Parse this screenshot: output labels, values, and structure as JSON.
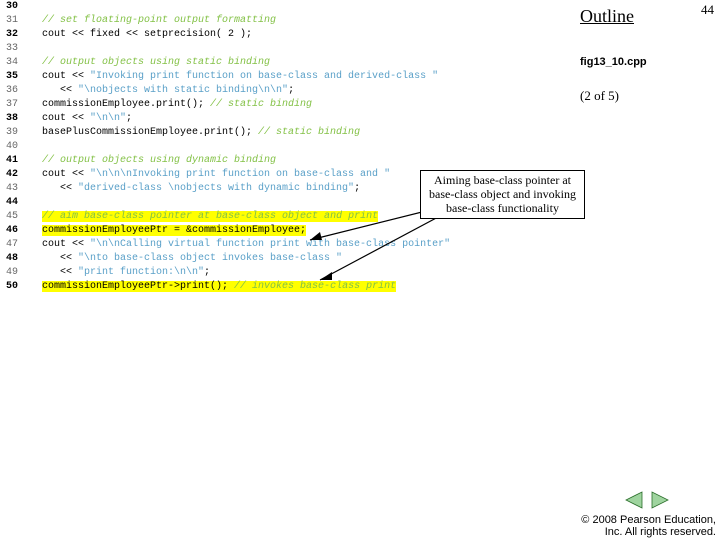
{
  "sidebar": {
    "outline": "Outline",
    "page_number": "44",
    "filename": "fig13_10.cpp",
    "progress": "(2 of 5)"
  },
  "callout": {
    "text": "Aiming base-class pointer at base-class object and invoking base-class functionality"
  },
  "copyright": {
    "line1": "© 2008 Pearson Education,",
    "line2": "Inc.  All rights reserved."
  },
  "nav": {
    "prev": "◀",
    "next": "▶"
  },
  "code": {
    "lines": [
      {
        "n": "30",
        "bold": true,
        "seg": []
      },
      {
        "n": "31",
        "seg": [
          {
            "t": "   "
          },
          {
            "t": "// set floating-point output formatting",
            "c": "comment"
          }
        ]
      },
      {
        "n": "32",
        "bold": true,
        "seg": [
          {
            "t": "   cout << fixed << setprecision( 2 );"
          }
        ]
      },
      {
        "n": "33",
        "seg": []
      },
      {
        "n": "34",
        "seg": [
          {
            "t": "   "
          },
          {
            "t": "// output objects using static binding",
            "c": "comment"
          }
        ]
      },
      {
        "n": "35",
        "bold": true,
        "seg": [
          {
            "t": "   cout << "
          },
          {
            "t": "\"Invoking print function on base-class and derived-class \"",
            "c": "str"
          }
        ]
      },
      {
        "n": "36",
        "seg": [
          {
            "t": "      << "
          },
          {
            "t": "\"\\nobjects with static binding\\n\\n\"",
            "c": "str"
          },
          {
            "t": ";"
          }
        ]
      },
      {
        "n": "37",
        "seg": [
          {
            "t": "   commissionEmployee.print(); "
          },
          {
            "t": "// static binding",
            "c": "comment"
          }
        ]
      },
      {
        "n": "38",
        "bold": true,
        "seg": [
          {
            "t": "   cout << "
          },
          {
            "t": "\"\\n\\n\"",
            "c": "str"
          },
          {
            "t": ";"
          }
        ]
      },
      {
        "n": "39",
        "seg": [
          {
            "t": "   basePlusCommissionEmployee.print(); "
          },
          {
            "t": "// static binding",
            "c": "comment"
          }
        ]
      },
      {
        "n": "40",
        "seg": []
      },
      {
        "n": "41",
        "bold": true,
        "seg": [
          {
            "t": "   "
          },
          {
            "t": "// output objects using dynamic binding",
            "c": "comment"
          }
        ]
      },
      {
        "n": "42",
        "bold": true,
        "seg": [
          {
            "t": "   cout << "
          },
          {
            "t": "\"\\n\\n\\nInvoking print function on base-class and \"",
            "c": "str"
          }
        ]
      },
      {
        "n": "43",
        "seg": [
          {
            "t": "      << "
          },
          {
            "t": "\"derived-class \\nobjects with dynamic binding\"",
            "c": "str"
          },
          {
            "t": ";"
          }
        ]
      },
      {
        "n": "44",
        "bold": true,
        "seg": []
      },
      {
        "n": "45",
        "seg": [
          {
            "t": "   "
          },
          {
            "t": "// aim base-class pointer at base-class object and print",
            "c": "comment hl"
          }
        ]
      },
      {
        "n": "46",
        "bold": true,
        "seg": [
          {
            "t": "   "
          },
          {
            "t": "commissionEmployeePtr = &commissionEmployee;",
            "c": "hl"
          }
        ]
      },
      {
        "n": "47",
        "seg": [
          {
            "t": "   cout << "
          },
          {
            "t": "\"\\n\\nCalling virtual function print with base-class pointer\"",
            "c": "str"
          }
        ]
      },
      {
        "n": "48",
        "bold": true,
        "seg": [
          {
            "t": "      << "
          },
          {
            "t": "\"\\nto base-class object invokes base-class \"",
            "c": "str"
          }
        ]
      },
      {
        "n": "49",
        "seg": [
          {
            "t": "      << "
          },
          {
            "t": "\"print function:\\n\\n\"",
            "c": "str"
          },
          {
            "t": ";"
          }
        ]
      },
      {
        "n": "50",
        "bold": true,
        "seg": [
          {
            "t": "   "
          },
          {
            "t": "commissionEmployeePtr->print(); ",
            "c": "hl"
          },
          {
            "t": "// invokes base-class print",
            "c": "comment hl"
          }
        ]
      }
    ]
  }
}
